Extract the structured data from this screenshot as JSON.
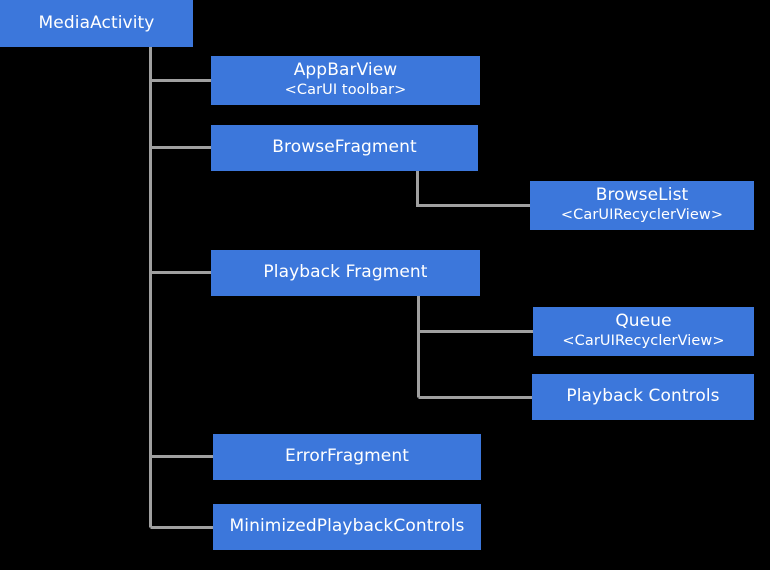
{
  "diagram": {
    "type": "hierarchy-tree",
    "background_color": "#000000",
    "node_color": "#3c77db",
    "node_text_color": "#ffffff",
    "connector_color": "#a0a0a0",
    "nodes": [
      {
        "id": "mediaactivity",
        "title": "MediaActivity",
        "subtitle": ""
      },
      {
        "id": "appbarview",
        "title": "AppBarView",
        "subtitle": "<CarUI toolbar>"
      },
      {
        "id": "browsefragment",
        "title": "BrowseFragment",
        "subtitle": ""
      },
      {
        "id": "browselist",
        "title": "BrowseList",
        "subtitle": "<CarUIRecyclerView>"
      },
      {
        "id": "playbackfragment",
        "title": "Playback Fragment",
        "subtitle": ""
      },
      {
        "id": "queue",
        "title": "Queue",
        "subtitle": "<CarUIRecyclerView>"
      },
      {
        "id": "playbackcontrols",
        "title": "Playback Controls",
        "subtitle": ""
      },
      {
        "id": "errorfragment",
        "title": "ErrorFragment",
        "subtitle": ""
      },
      {
        "id": "minimizedplaybackcontrols",
        "title": "MinimizedPlaybackControls",
        "subtitle": ""
      }
    ],
    "edges": [
      {
        "from": "mediaactivity",
        "to": "appbarview"
      },
      {
        "from": "mediaactivity",
        "to": "browsefragment"
      },
      {
        "from": "mediaactivity",
        "to": "playbackfragment"
      },
      {
        "from": "mediaactivity",
        "to": "errorfragment"
      },
      {
        "from": "mediaactivity",
        "to": "minimizedplaybackcontrols"
      },
      {
        "from": "browsefragment",
        "to": "browselist"
      },
      {
        "from": "playbackfragment",
        "to": "queue"
      },
      {
        "from": "playbackfragment",
        "to": "playbackcontrols"
      }
    ]
  }
}
